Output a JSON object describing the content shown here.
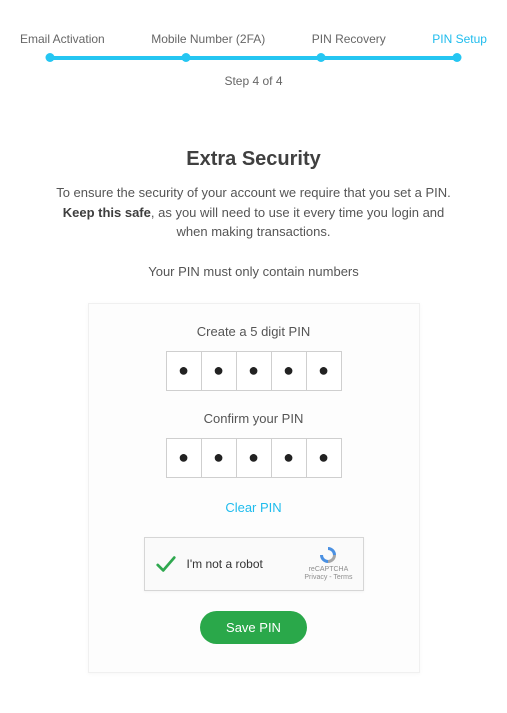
{
  "stepper": {
    "steps": [
      "Email Activation",
      "Mobile Number (2FA)",
      "PIN Recovery",
      "PIN Setup"
    ],
    "active_index": 3,
    "counter": "Step 4 of 4"
  },
  "header": {
    "title": "Extra Security",
    "lead_pre": "To ensure the security of your account we require that you set a PIN. ",
    "lead_bold": "Keep this safe",
    "lead_post": ", as you will need to use it every time you login and when making transactions.",
    "rule": "Your PIN must only contain numbers"
  },
  "form": {
    "create_label": "Create a 5 digit PIN",
    "confirm_label": "Confirm your PIN",
    "mask_glyph": "●",
    "create_values": [
      "●",
      "●",
      "●",
      "●",
      "●"
    ],
    "confirm_values": [
      "●",
      "●",
      "●",
      "●",
      "●"
    ],
    "clear_label": "Clear PIN",
    "submit_label": "Save PIN"
  },
  "recaptcha": {
    "label": "I'm not a robot",
    "brand": "reCAPTCHA",
    "legal": "Privacy - Terms",
    "checked": true
  }
}
